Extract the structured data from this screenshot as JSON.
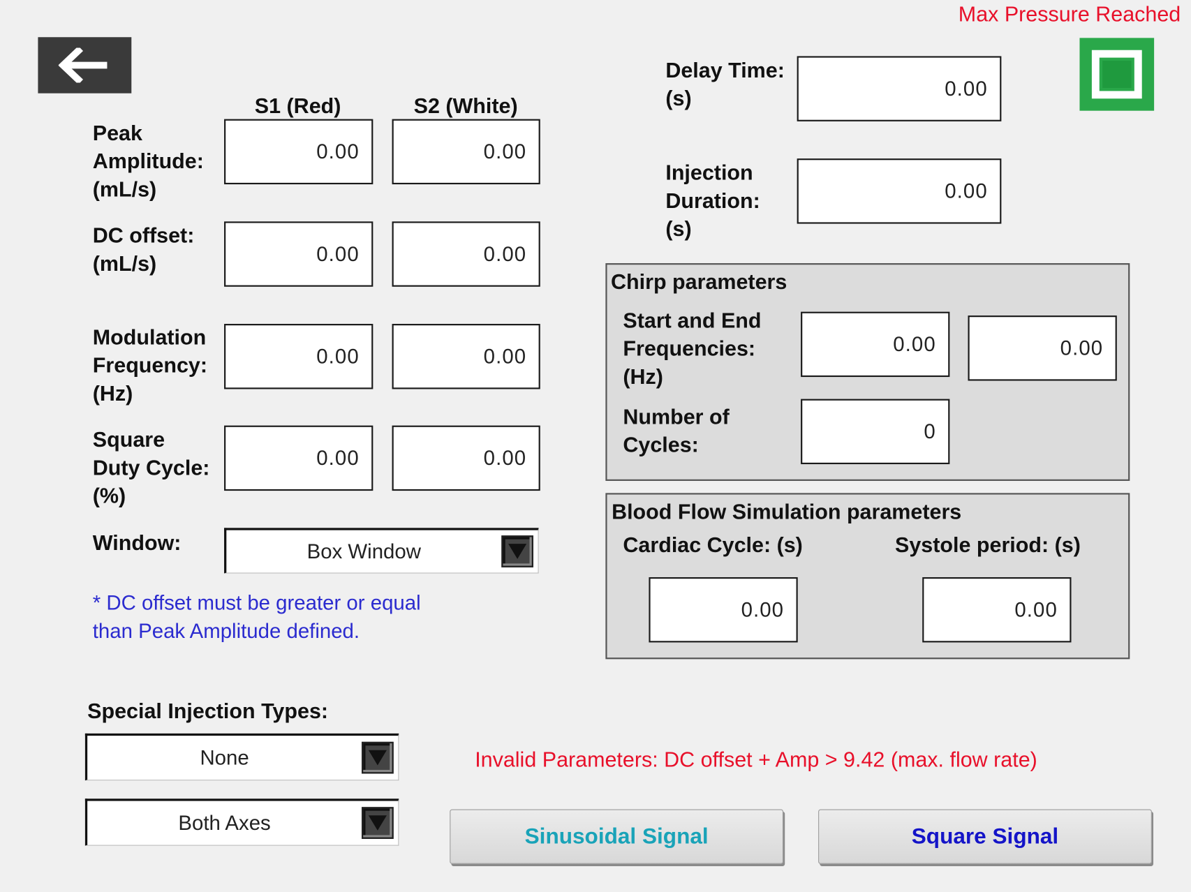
{
  "header": {
    "max_pressure_text": "Max Pressure Reached",
    "back_icon": "arrow-left-icon"
  },
  "colors": {
    "warning_red": "#e8102a",
    "note_blue": "#2b2bcf",
    "sinusoidal_label": "#19a3b8",
    "square_label": "#1414c8",
    "status_green": "#2aa84a",
    "back_button_bg": "#3a3a3a"
  },
  "columns": {
    "s1": "S1 (Red)",
    "s2": "S2 (White)"
  },
  "rows": {
    "peak_amplitude": {
      "label": [
        "Peak",
        "Amplitude:",
        "(mL/s)"
      ],
      "s1": "0.00",
      "s2": "0.00"
    },
    "dc_offset": {
      "label": [
        "DC offset:",
        "(mL/s)"
      ],
      "s1": "0.00",
      "s2": "0.00"
    },
    "modulation_frequency": {
      "label": [
        "Modulation",
        "Frequency:",
        "(Hz)"
      ],
      "s1": "0.00",
      "s2": "0.00"
    },
    "square_duty_cycle": {
      "label": [
        "Square",
        "Duty Cycle:",
        "(%)"
      ],
      "s1": "0.00",
      "s2": "0.00"
    }
  },
  "window": {
    "label": "Window:",
    "selected": "Box Window"
  },
  "note": {
    "line1": "* DC offset must be greater or equal",
    "line2": "than Peak Amplitude defined."
  },
  "delay_time": {
    "label": [
      "Delay Time:",
      "(s)"
    ],
    "value": "0.00"
  },
  "injection_duration": {
    "label": [
      "Injection",
      "Duration:",
      "(s)"
    ],
    "value": "0.00"
  },
  "chirp": {
    "title": "Chirp parameters",
    "freq_label": [
      "Start and End",
      "Frequencies:",
      "(Hz)"
    ],
    "start_freq": "0.00",
    "end_freq": "0.00",
    "cycles_label": [
      "Number of",
      "Cycles:"
    ],
    "cycles": "0"
  },
  "blood_flow": {
    "title": "Blood Flow Simulation parameters",
    "cardiac_label": "Cardiac Cycle: (s)",
    "cardiac_value": "0.00",
    "systole_label": "Systole period: (s)",
    "systole_value": "0.00"
  },
  "special_injection": {
    "label": "Special Injection Types:",
    "type_selected": "None",
    "axes_selected": "Both Axes"
  },
  "validation": {
    "message": "Invalid Parameters: DC offset + Amp > 9.42 (max. flow rate)"
  },
  "buttons": {
    "sinusoidal": "Sinusoidal Signal",
    "square": "Square Signal"
  },
  "status": {
    "icon": "stop-indicator-icon"
  }
}
